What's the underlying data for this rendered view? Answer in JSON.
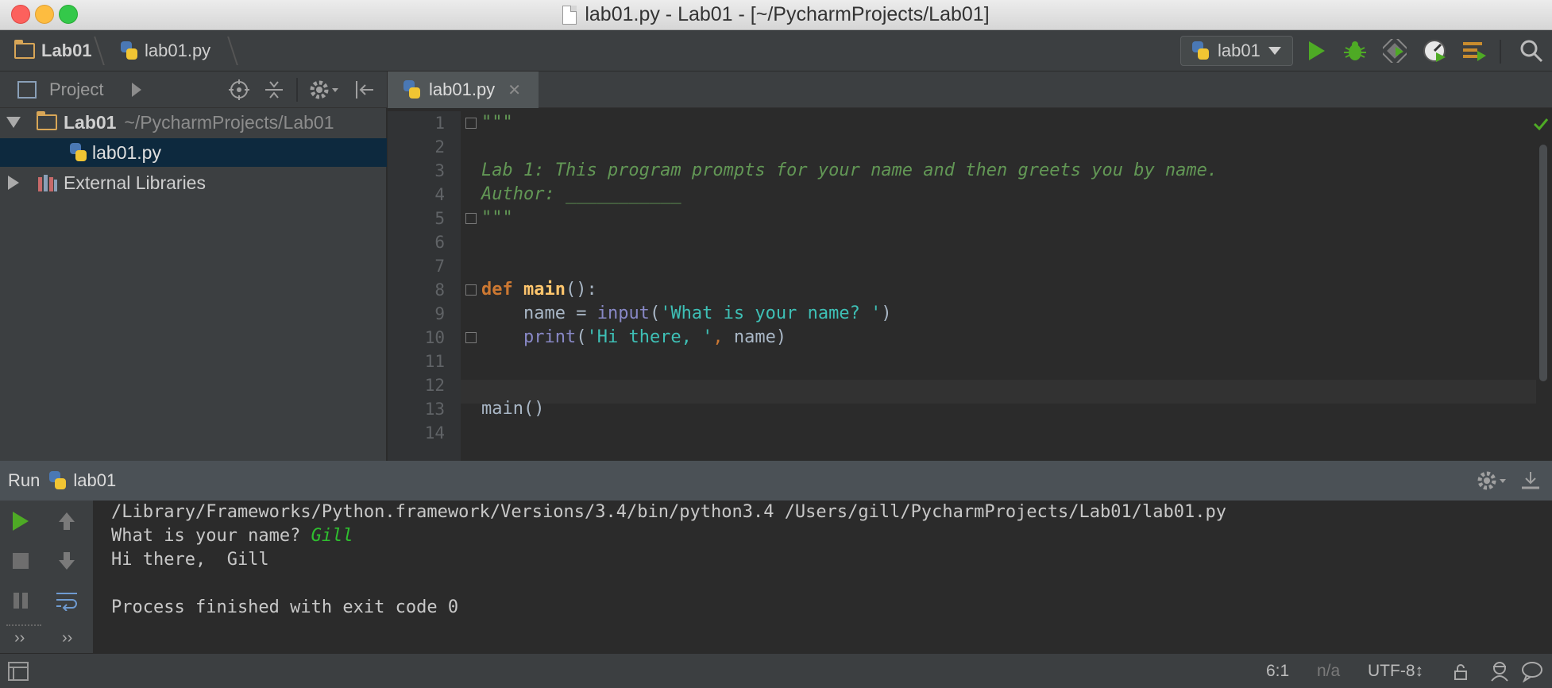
{
  "window": {
    "title": "lab01.py - Lab01 - [~/PycharmProjects/Lab01]"
  },
  "navbar": {
    "crumbs": [
      "Lab01",
      "lab01.py"
    ],
    "run_config": "lab01"
  },
  "project_pane": {
    "header_label": "Project",
    "tree": [
      {
        "name": "Lab01",
        "path": "~/PycharmProjects/Lab01",
        "expanded": true
      },
      {
        "name": "lab01.py",
        "selected": true
      },
      {
        "name": "External Libraries",
        "expanded": false
      }
    ]
  },
  "editor": {
    "tab_label": "lab01.py",
    "line_numbers": [
      "1",
      "2",
      "3",
      "4",
      "5",
      "6",
      "7",
      "8",
      "9",
      "10",
      "11",
      "12",
      "13",
      "14"
    ],
    "lines": {
      "l1": "\"\"\"",
      "l3": "Lab 1: This program prompts for your name and then greets you by name.",
      "l4": "Author: ___________",
      "l5": "\"\"\"",
      "l8_kw": "def ",
      "l8_fn": "main",
      "l8_rest": "():",
      "l9_a": "    name = ",
      "l9_builtin": "input",
      "l9_b": "(",
      "l9_str": "'What is your name? '",
      "l9_c": ")",
      "l10_builtin": "    print",
      "l10_a": "(",
      "l10_str": "'Hi there, '",
      "l10_comma": ",",
      "l10_b": " name)",
      "l13": "main()"
    }
  },
  "run_panel": {
    "label": "Run",
    "config": "lab01",
    "console": {
      "cmd": "/Library/Frameworks/Python.framework/Versions/3.4/bin/python3.4 /Users/gill/PycharmProjects/Lab01/lab01.py",
      "prompt": "What is your name? ",
      "input": "Gill",
      "greeting": "Hi there,  Gill",
      "exit": "Process finished with exit code 0"
    }
  },
  "statusbar": {
    "position": "6:1",
    "line_sep": "n/a",
    "encoding": "UTF-8↕"
  },
  "colors": {
    "run_green": "#4eaa25",
    "docstring": "#629755",
    "keyword": "#cc7832",
    "function": "#ffc66d",
    "user_input": "#2fbf2f"
  }
}
